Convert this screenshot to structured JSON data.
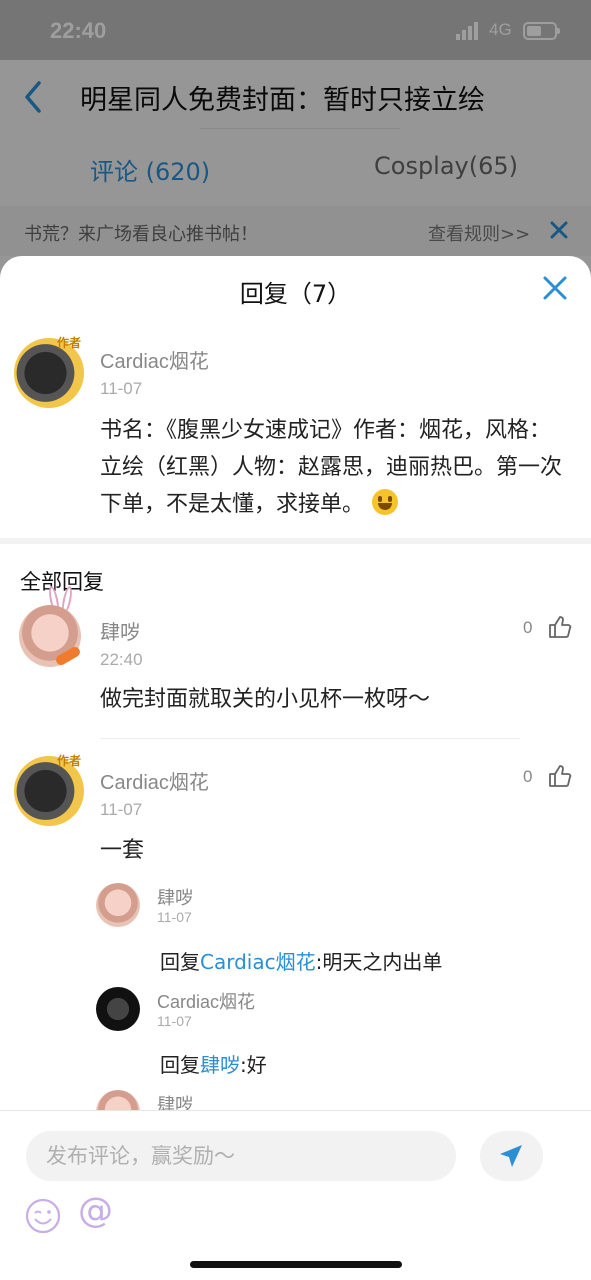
{
  "status": {
    "time": "22:40",
    "network": "4G"
  },
  "header": {
    "title": "明星同人免费封面：暂时只接立绘",
    "tabs": [
      {
        "label": "评论 (620)",
        "active": true
      },
      {
        "label": "Cosplay(65)",
        "active": false
      }
    ]
  },
  "notice": {
    "text": "书荒？来广场看良心推书帖！",
    "link": "查看规则>>"
  },
  "sheet": {
    "title": "回复（7）",
    "original": {
      "user": "Cardiac烟花",
      "badge": "作者",
      "date": "11-07",
      "content": "书名：《腹黑少女速成记》作者：烟花，风格：立绘（红黑）人物：赵露思，迪丽热巴。第一次下单，不是太懂，求接单。",
      "emoji": "grinning-emoji"
    },
    "section_title": "全部回复",
    "replies": [
      {
        "user": "肆哕",
        "time": "22:40",
        "likes": "0",
        "content": "做完封面就取关的小见杯一枚呀～"
      },
      {
        "user": "Cardiac烟花",
        "badge": "作者",
        "time": "11-07",
        "likes": "0",
        "content": "一套",
        "subreplies": [
          {
            "user": "肆哕",
            "date": "11-07",
            "prefix": "回复",
            "mention": "Cardiac烟花",
            "text": ":明天之内出单"
          },
          {
            "user": "Cardiac烟花",
            "date": "11-07",
            "prefix": "回复",
            "mention": "肆哕",
            "text": ":好"
          },
          {
            "user": "肆哕"
          }
        ]
      }
    ]
  },
  "input": {
    "placeholder": "发布评论，赢奖励～",
    "at_symbol": "@"
  },
  "colors": {
    "accent": "#2b8fd6",
    "send_icon": "#2b8fd6"
  }
}
